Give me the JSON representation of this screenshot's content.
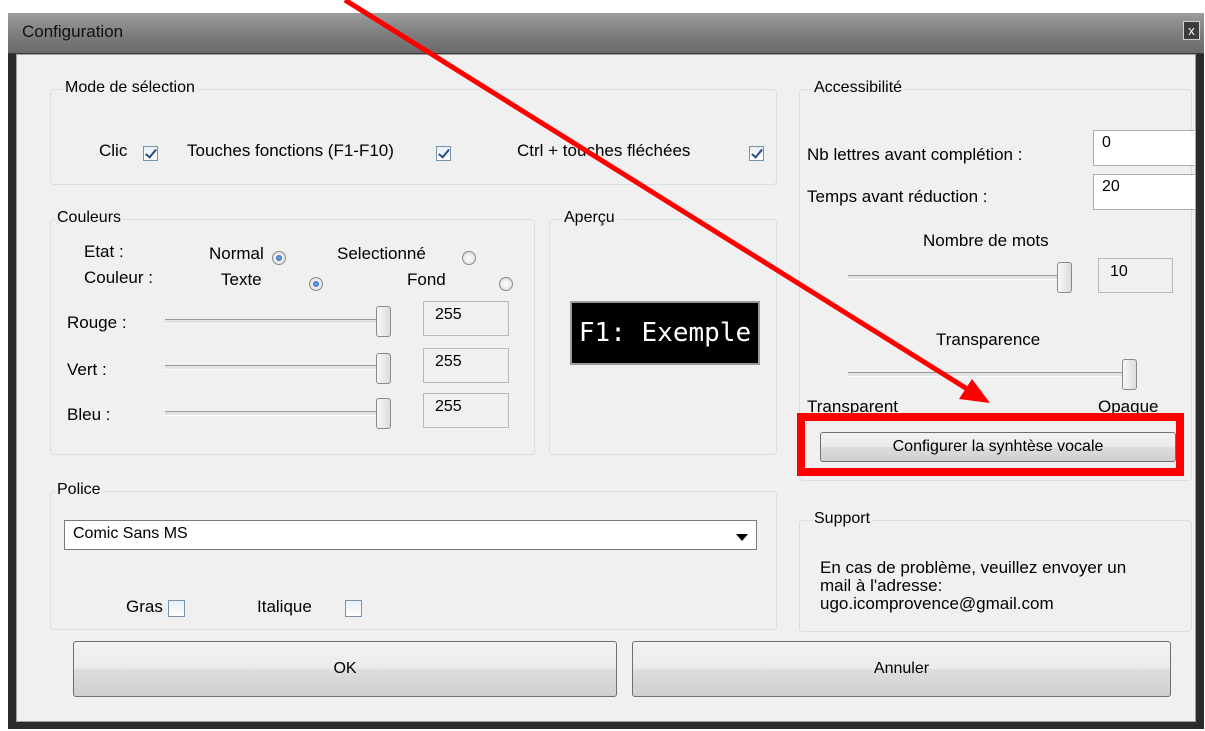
{
  "window": {
    "title": "Configuration",
    "close_glyph": "x"
  },
  "selection_mode": {
    "label": "Mode de sélection",
    "click": "Clic",
    "function_keys": "Touches fonctions (F1-F10)",
    "ctrl_arrows": "Ctrl + touches fléchées"
  },
  "colors": {
    "label": "Couleurs",
    "state_label": "Etat :",
    "normal": "Normal",
    "selected": "Selectionné",
    "color_label": "Couleur :",
    "text": "Texte",
    "background": "Fond",
    "red_label": "Rouge :",
    "red_value": "255",
    "green_label": "Vert :",
    "green_value": "255",
    "blue_label": "Bleu :",
    "blue_value": "255"
  },
  "preview": {
    "label": "Aperçu",
    "text": "F1: Exemple"
  },
  "accessibility": {
    "label": "Accessibilité",
    "letters_label": "Nb lettres avant complétion :",
    "letters_value": "0",
    "time_label": "Temps avant réduction :",
    "time_value": "20",
    "words_label": "Nombre de mots",
    "words_value": "10",
    "transparency_label": "Transparence",
    "transparent": "Transparent",
    "opaque": "Opaque",
    "tts_button": "Configurer la synhtèse vocale"
  },
  "font": {
    "label": "Police",
    "selected": "Comic Sans MS",
    "bold": "Gras",
    "italic": "Italique"
  },
  "support": {
    "label": "Support",
    "line1": "En cas de problème, veuillez envoyer un",
    "line2": "mail à l'adresse:",
    "email": "ugo.icomprovence@gmail.com"
  },
  "buttons": {
    "ok": "OK",
    "cancel": "Annuler"
  },
  "annotation": {
    "color": "#ff0000"
  }
}
